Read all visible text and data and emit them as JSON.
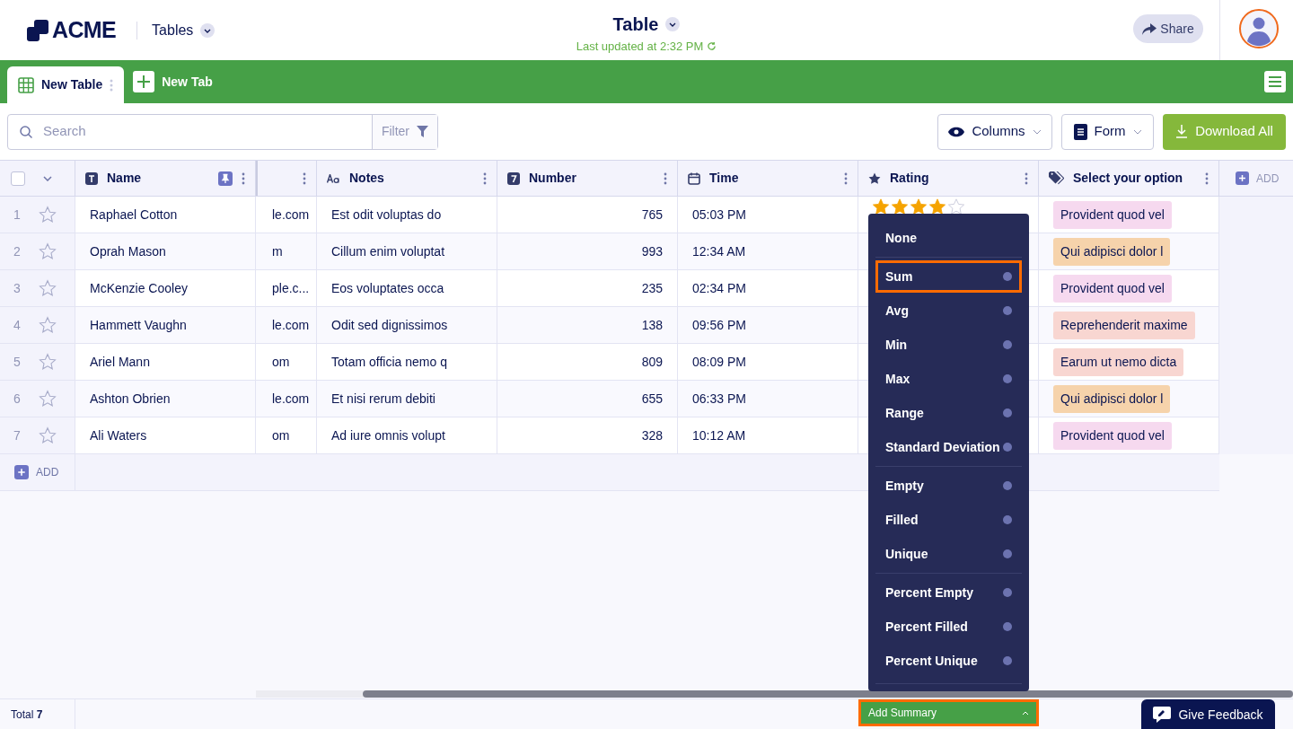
{
  "header": {
    "brand": "ACME",
    "section": "Tables",
    "title": "Table",
    "updated": "Last updated at 2:32 PM",
    "share": "Share"
  },
  "tabs": [
    {
      "label": "New Table",
      "selected": true
    },
    {
      "label": "New Tab",
      "selected": false
    }
  ],
  "toolbar": {
    "search_placeholder": "Search",
    "filter": "Filter",
    "columns": "Columns",
    "form": "Form",
    "download": "Download All"
  },
  "columns": [
    {
      "kind": "name",
      "label": "Name"
    },
    {
      "kind": "email"
    },
    {
      "kind": "notes",
      "label": "Notes"
    },
    {
      "kind": "number",
      "label": "Number"
    },
    {
      "kind": "time",
      "label": "Time"
    },
    {
      "kind": "rating",
      "label": "Rating"
    },
    {
      "kind": "option",
      "label": "Select your option"
    }
  ],
  "select_all_checked": false,
  "add_column": "ADD",
  "rows": [
    {
      "index": "1",
      "starred": false,
      "name": "Raphael Cotton",
      "email": "le.com",
      "notes": "Est odit voluptas do",
      "number": "765",
      "time": "05:03 PM",
      "stars": 4,
      "option": "Provident quod vel",
      "color": "#f6d9ef"
    },
    {
      "index": "2",
      "starred": false,
      "name": "Oprah Mason",
      "email": "m",
      "notes": "Cillum enim voluptat",
      "number": "993",
      "time": "12:34 AM",
      "option": "Qui adipisci dolor l",
      "color": "#f6d3ab"
    },
    {
      "index": "3",
      "starred": false,
      "name": "McKenzie Cooley",
      "email": "ple.c...",
      "notes": "Eos voluptates occa",
      "number": "235",
      "time": "02:34 PM",
      "option": "Provident quod vel",
      "color": "#f6d9ef"
    },
    {
      "index": "4",
      "starred": false,
      "name": "Hammett Vaughn",
      "email": "le.com",
      "notes": "Odit sed dignissimos",
      "number": "138",
      "time": "09:56 PM",
      "option": "Reprehenderit maxime",
      "color": "#f8d6d1"
    },
    {
      "index": "5",
      "starred": false,
      "name": "Ariel Mann",
      "email": "om",
      "notes": "Totam officia nemo q",
      "number": "809",
      "time": "08:09 PM",
      "option": "Earum ut nemo dicta",
      "color": "#f8d6d1"
    },
    {
      "index": "6",
      "starred": false,
      "name": "Ashton Obrien",
      "email": "le.com",
      "notes": "Et nisi rerum debiti",
      "number": "655",
      "time": "06:33 PM",
      "option": "Qui adipisci dolor l",
      "color": "#f6d3ab"
    },
    {
      "index": "7",
      "starred": false,
      "name": "Ali Waters",
      "email": "om",
      "notes": "Ad iure omnis volupt",
      "number": "328",
      "time": "10:12 AM",
      "option": "Provident quod vel",
      "color": "#f6d9ef"
    }
  ],
  "add_row": "ADD",
  "summary_menu": [
    [
      {
        "label": "None",
        "kind": "clear",
        "selected": false
      }
    ],
    [
      {
        "label": "Sum",
        "kind": "aggregate",
        "selected": true
      },
      {
        "label": "Avg",
        "kind": "aggregate",
        "selected": false
      },
      {
        "label": "Min",
        "kind": "aggregate",
        "selected": false
      },
      {
        "label": "Max",
        "kind": "aggregate",
        "selected": false
      },
      {
        "label": "Range",
        "kind": "aggregate",
        "selected": false
      },
      {
        "label": "Standard Deviation",
        "kind": "aggregate",
        "selected": false
      }
    ],
    [
      {
        "label": "Empty",
        "kind": "aggregate",
        "selected": false
      },
      {
        "label": "Filled",
        "kind": "aggregate",
        "selected": false
      },
      {
        "label": "Unique",
        "kind": "aggregate",
        "selected": false
      }
    ],
    [
      {
        "label": "Percent Empty",
        "kind": "aggregate",
        "selected": false
      },
      {
        "label": "Percent Filled",
        "kind": "aggregate",
        "selected": false
      },
      {
        "label": "Percent Unique",
        "kind": "aggregate",
        "selected": false
      }
    ]
  ],
  "footer": {
    "total": "Total **7**",
    "add_summary": "Add Summary",
    "feedback": "Give Feedback"
  }
}
